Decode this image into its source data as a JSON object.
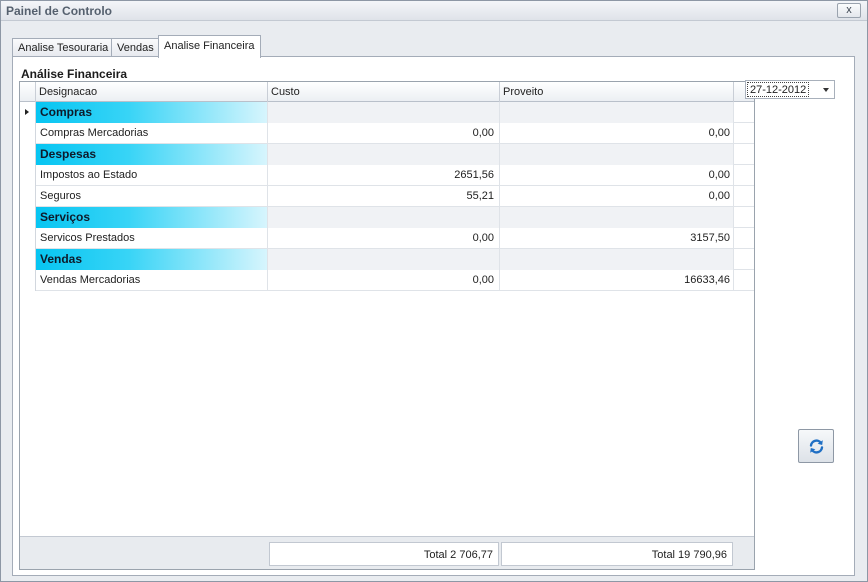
{
  "window": {
    "title": "Painel de Controlo",
    "close_label": "x"
  },
  "tabs": [
    {
      "label": "Analise Tesouraria"
    },
    {
      "label": "Vendas"
    },
    {
      "label": "Analise Financeira"
    }
  ],
  "section_title": "Análise Financeira",
  "grid": {
    "columns": [
      "Designacao",
      "Custo",
      "Proveito"
    ],
    "rows": [
      {
        "type": "group",
        "designacao": "Compras",
        "custo": "",
        "proveito": ""
      },
      {
        "type": "item",
        "designacao": "Compras Mercadorias",
        "custo": "0,00",
        "proveito": "0,00"
      },
      {
        "type": "group",
        "designacao": "Despesas",
        "custo": "",
        "proveito": ""
      },
      {
        "type": "item",
        "designacao": "Impostos ao Estado",
        "custo": "2651,56",
        "proveito": "0,00"
      },
      {
        "type": "item",
        "designacao": "Seguros",
        "custo": "55,21",
        "proveito": "0,00"
      },
      {
        "type": "group",
        "designacao": "Serviços",
        "custo": "",
        "proveito": ""
      },
      {
        "type": "item",
        "designacao": "Servicos Prestados",
        "custo": "0,00",
        "proveito": "3157,50"
      },
      {
        "type": "group",
        "designacao": "Vendas",
        "custo": "",
        "proveito": ""
      },
      {
        "type": "item",
        "designacao": "Vendas Mercadorias",
        "custo": "0,00",
        "proveito": "16633,46"
      }
    ],
    "totals": {
      "custo": "Total  2 706,77",
      "proveito": "Total  19 790,96"
    }
  },
  "date_picker": {
    "value": "27-12-2012"
  },
  "icons": {
    "refresh": "refresh-icon",
    "dropdown": "chevron-down-icon"
  },
  "colors": {
    "group_gradient_start": "#07c5f2",
    "refresh_icon": "#1f6fc4"
  }
}
